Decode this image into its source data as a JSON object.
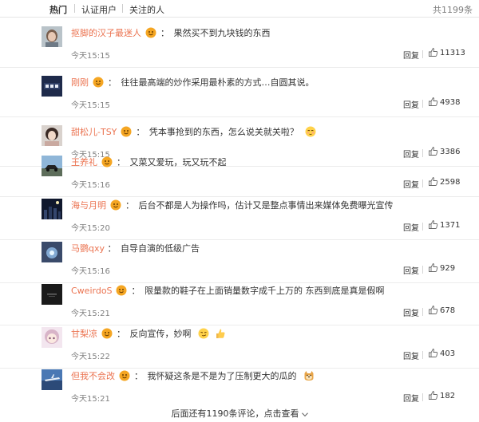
{
  "tabs": {
    "hot": "热门",
    "verified": "认证用户",
    "following": "关注的人"
  },
  "total_count": "共1199条",
  "reply_label": "回复",
  "comments": [
    {
      "user": "抠脚的汉子最迷人",
      "text": "果然买不到九块钱的东西",
      "time": "今天15:15",
      "likes": "11313",
      "avatar": "avatar-woman-photo",
      "emoji": ""
    },
    {
      "user": "刚刚",
      "text": "往往最高端的炒作采用最朴素的方式…自圆其说。",
      "time": "今天15:15",
      "likes": "4938",
      "avatar": "avatar-text-logo",
      "emoji": ""
    },
    {
      "user": "甜松儿-TSY",
      "text": "凭本事抢到的东西，怎么说关就关啦？",
      "time": "今天15:15",
      "likes": "3386",
      "avatar": "avatar-girl-photo",
      "emoji": "shy-face-emoji"
    },
    {
      "user": "王养礼",
      "text": "又菜又爱玩，玩又玩不起",
      "time": "今天15:16",
      "likes": "2598",
      "avatar": "avatar-car-photo",
      "emoji": ""
    },
    {
      "user": "海与月明",
      "text": "后台不都是人为操作吗，估计又是整点事情出来媒体免费曝光宣传",
      "time": "今天15:20",
      "likes": "1371",
      "avatar": "avatar-night-city-photo",
      "emoji": ""
    },
    {
      "user": "马鹦qxy",
      "text": "自导自演的低级广告",
      "time": "今天15:16",
      "likes": "929",
      "avatar": "avatar-glow-photo",
      "emoji": ""
    },
    {
      "user": "CweirdoS",
      "text": "限量款的鞋子在上面销量数字成千上万的 东西到底是真是假啊",
      "time": "今天15:21",
      "likes": "678",
      "avatar": "avatar-dark-photo",
      "emoji": ""
    },
    {
      "user": "甘梨凉",
      "text": "反向宣传，妙啊",
      "time": "今天15:22",
      "likes": "403",
      "avatar": "avatar-anime-girl",
      "emoji": "smirk-face-emoji,thumbs-up-emoji"
    },
    {
      "user": "但我不会改",
      "text": "我怀疑这条是不是为了压制更大的瓜的",
      "time": "今天15:21",
      "likes": "182",
      "avatar": "avatar-plane-photo",
      "emoji": "doge-emoji"
    }
  ],
  "footer": {
    "text": "后面还有1190条评论，",
    "link": "点击查看"
  },
  "colors": {
    "username": "#eb7350",
    "time": "#808080",
    "divider": "#ececec",
    "badge": "#f5a623"
  }
}
